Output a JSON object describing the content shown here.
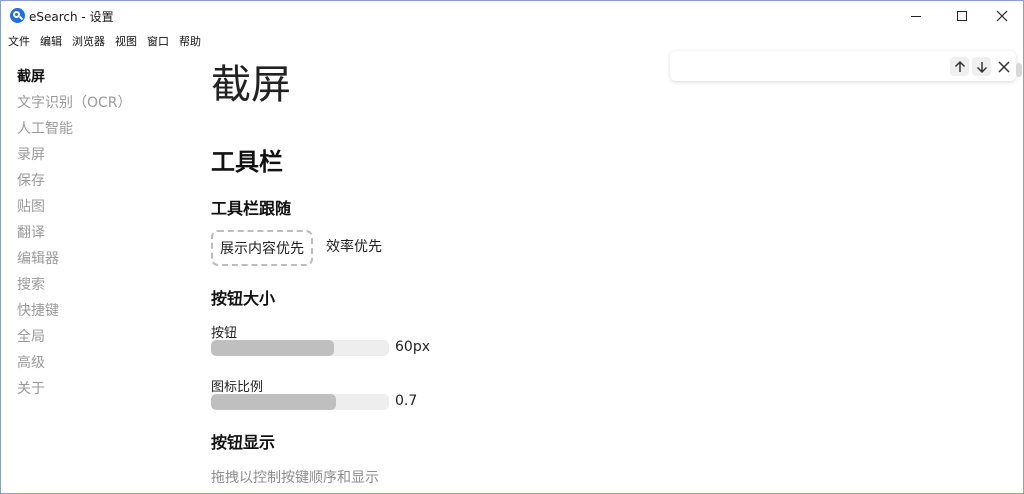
{
  "window": {
    "title": "eSearch - 设置",
    "icon": "esearch-logo-icon"
  },
  "menu": [
    "文件",
    "编辑",
    "浏览器",
    "视图",
    "窗口",
    "帮助"
  ],
  "sidebar": {
    "items": [
      {
        "label": "截屏",
        "active": true
      },
      {
        "label": "文字识别（OCR）",
        "active": false
      },
      {
        "label": "人工智能",
        "active": false
      },
      {
        "label": "录屏",
        "active": false
      },
      {
        "label": "保存",
        "active": false
      },
      {
        "label": "贴图",
        "active": false
      },
      {
        "label": "翻译",
        "active": false
      },
      {
        "label": "编辑器",
        "active": false
      },
      {
        "label": "搜索",
        "active": false
      },
      {
        "label": "快捷键",
        "active": false
      },
      {
        "label": "全局",
        "active": false
      },
      {
        "label": "高级",
        "active": false
      },
      {
        "label": "关于",
        "active": false
      }
    ]
  },
  "find": {
    "value": "",
    "up_icon": "arrow-up-icon",
    "down_icon": "arrow-down-icon",
    "close_icon": "close-icon"
  },
  "main": {
    "page_title": "截屏",
    "section_title": "工具栏",
    "follow": {
      "title": "工具栏跟随",
      "options": [
        "展示内容优先",
        "效率优先"
      ],
      "selected": "展示内容优先"
    },
    "size": {
      "title": "按钮大小",
      "button_label": "按钮",
      "button_value": "60px",
      "button_fill": 0.69,
      "icon_label": "图标比例",
      "icon_value": "0.7",
      "icon_fill": 0.7
    },
    "display": {
      "title": "按钮显示",
      "hint": "拖拽以控制按键顺序和显示"
    }
  },
  "colors": {
    "accent": "#1e6ee6",
    "slider_fill": "#bfbfbf",
    "slider_track": "#eeeeee",
    "muted_text": "#9a9a9a"
  }
}
